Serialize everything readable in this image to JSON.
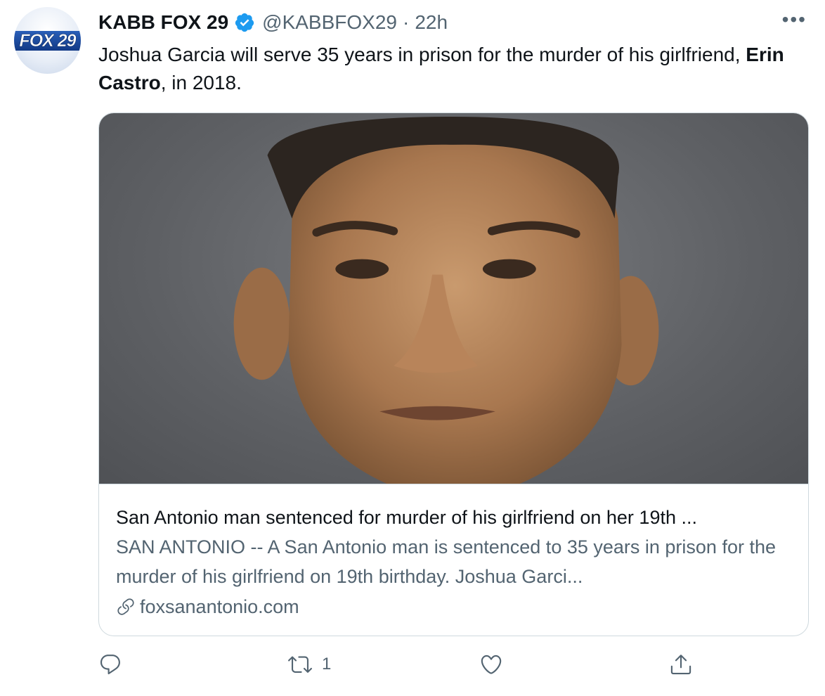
{
  "author": {
    "avatar_logo": "FOX 29",
    "display_name": "KABB FOX 29",
    "handle": "@KABBFOX29",
    "separator": "·",
    "timestamp": "22h",
    "verified": true
  },
  "more_menu": "•••",
  "tweet": {
    "text_part1": "Joshua Garcia will serve 35 years in prison for the murder of his girlfriend, ",
    "text_bold": "Erin Castro",
    "text_part2": ", in 2018."
  },
  "card": {
    "title": "San Antonio man sentenced for murder of his girlfriend on her 19th ...",
    "description": "SAN ANTONIO -- A San Antonio man is sentenced to 35 years in prison for the murder of his girlfriend on 19th birthday. Joshua Garci...",
    "domain": "foxsanantonio.com",
    "link_icon": "link-icon"
  },
  "actions": {
    "reply": {
      "icon": "reply-icon",
      "count": ""
    },
    "retweet": {
      "icon": "retweet-icon",
      "count": "1"
    },
    "like": {
      "icon": "heart-icon",
      "count": ""
    },
    "share": {
      "icon": "share-icon",
      "count": ""
    }
  },
  "colors": {
    "primary_text": "#0f1419",
    "secondary_text": "#536471",
    "verified_blue": "#1d9bf0",
    "border": "#cfd9de"
  }
}
